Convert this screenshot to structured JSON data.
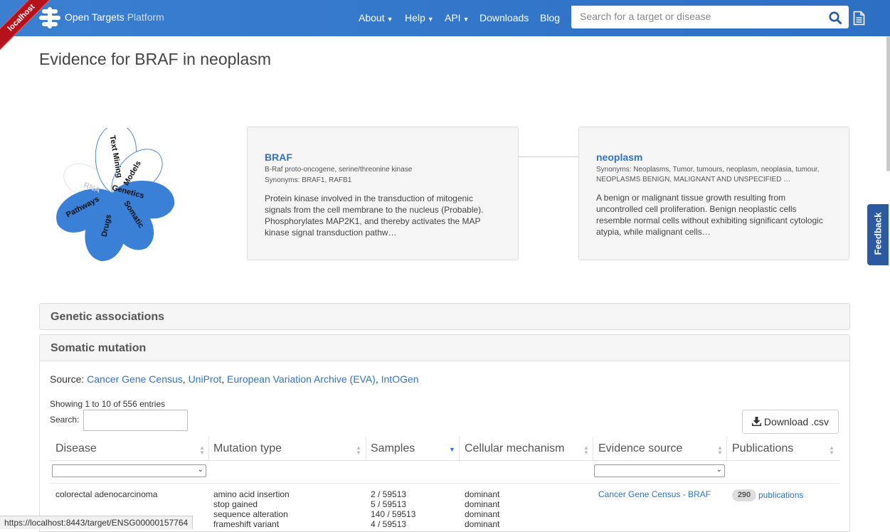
{
  "ribbon": "localhost",
  "brand": {
    "name": "Open Targets",
    "product": "Platform"
  },
  "nav": {
    "about": "About",
    "help": "Help",
    "api": "API",
    "downloads": "Downloads",
    "blog": "Blog"
  },
  "search": {
    "placeholder": "Search for a target or disease"
  },
  "page_title": "Evidence for BRAF in neoplasm",
  "flower": {
    "petals": [
      "Genetics",
      "Somatic",
      "Drugs",
      "Pathways",
      "RNA",
      "Text Mining",
      "Models"
    ],
    "active_color": "#3a80d6",
    "inactive_color": "#ffffff"
  },
  "target": {
    "name": "BRAF",
    "full_name": "B-Raf proto-oncogene, serine/threonine kinase",
    "synonyms": "Synonyms: BRAF1, RAFB1",
    "desc1": "Protein kinase involved in the transduction of mitogenic",
    "desc2": "signals from the cell membrane to the nucleus (Probable).",
    "desc3": "Phosphorylates MAP2K1, and thereby activates the MAP",
    "desc4": "kinase signal transduction pathw…"
  },
  "disease": {
    "name": "neoplasm",
    "synonyms1": "Synonyms: Neoplasms, Tumor, tumours, neoplasm, neoplasia, tumour,",
    "synonyms2": "NEOPLASMS BENIGN, MALIGNANT AND UNSPECIFIED …",
    "desc1": "A benign or malignant tissue growth resulting from",
    "desc2": "uncontrolled cell proliferation. Benign neoplastic cells",
    "desc3": "resemble normal cells without exhibiting significant cytologic",
    "desc4": "atypia, while malignant cells…"
  },
  "feedback": "Feedback",
  "sections": {
    "genetic": "Genetic associations",
    "somatic": "Somatic mutation"
  },
  "source": {
    "label": "Source:",
    "links": [
      "Cancer Gene Census",
      "UniProt",
      "European Variation Archive (EVA)",
      "IntOGen"
    ]
  },
  "table": {
    "showing": "Showing 1 to 10 of 556 entries",
    "search_label": "Search:",
    "download": "Download .csv",
    "headers": [
      "Disease",
      "Mutation type",
      "Samples",
      "Cellular mechanism",
      "Evidence source",
      "Publications"
    ],
    "row1": {
      "disease": "colorectal adenocarcinoma",
      "mutation_types": [
        "amino acid insertion",
        "stop gained",
        "sequence alteration",
        "frameshift variant"
      ],
      "samples": [
        "2 / 59513",
        "5 / 59513",
        "140 / 59513",
        "4 / 59513"
      ],
      "mechanisms": [
        "dominant",
        "dominant",
        "dominant",
        "dominant"
      ],
      "evidence_source": "Cancer Gene Census - BRAF",
      "pub_count": "290",
      "pub_label": "publications"
    }
  },
  "status_url": "https://localhost:8443/target/ENSG00000157764"
}
